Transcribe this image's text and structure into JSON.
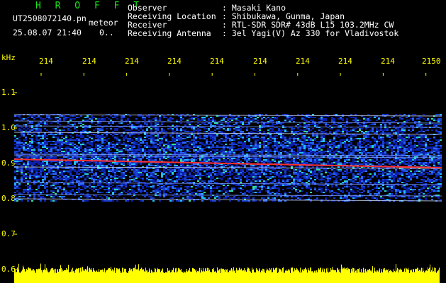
{
  "header": {
    "title": "H R O F F T",
    "filename": "UT2508072140.pn",
    "type_label": "meteor",
    "datetime": "25.08.07 21:40",
    "count": "0..",
    "labels": [
      "Observer",
      "Receiving Location",
      "Receiver",
      "Receiving Antenna"
    ],
    "values": [
      ": Masaki Kano",
      ": Shibukawa, Gunma, Japan",
      ": RTL-SDR SDR# 43dB L15 103.2MHz CW",
      ": 3el Yagi(V) Az 330 for Vladivostok"
    ]
  },
  "axes": {
    "y_unit": "kHz",
    "y_ticks": [
      "1.1",
      "1.0",
      "0.9",
      "0.8",
      "0.7",
      "0.6"
    ],
    "x_ticks": [
      "214",
      "214",
      "214",
      "214",
      "214",
      "214",
      "214",
      "214",
      "214",
      "2150"
    ]
  },
  "colors": {
    "text": "#ffffff",
    "title": "#19e619",
    "axis": "#ffff00",
    "signal": "#ff3030"
  }
}
